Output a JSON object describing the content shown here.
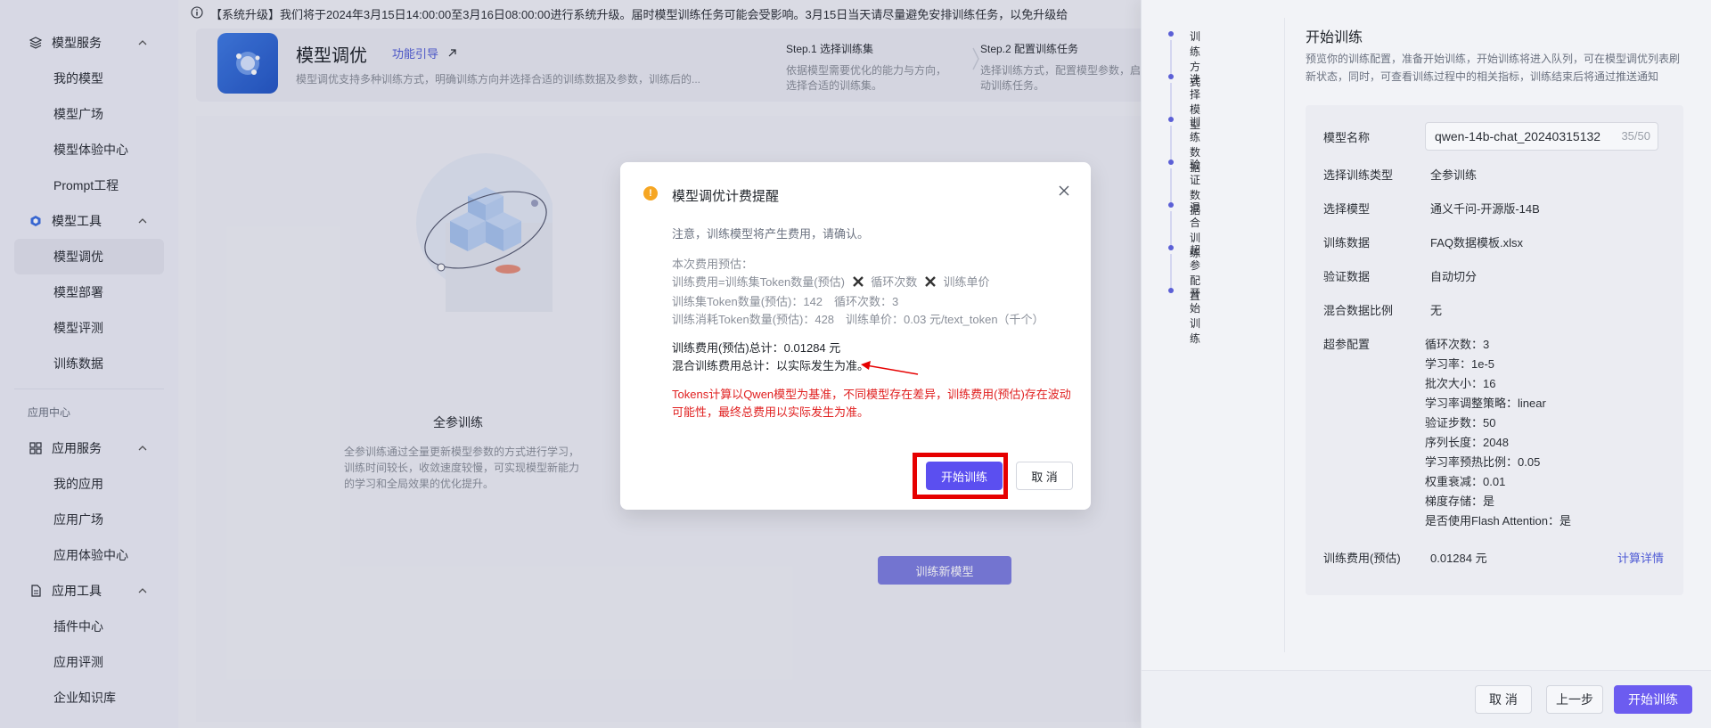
{
  "sidebar": {
    "groups": [
      {
        "label": "模型服务",
        "items": [
          "我的模型",
          "模型广场",
          "模型体验中心",
          "Prompt工程"
        ]
      },
      {
        "label": "模型工具",
        "items": [
          "模型调优",
          "模型部署",
          "模型评测",
          "训练数据"
        ]
      }
    ],
    "section_app": "应用中心",
    "app_groups": [
      {
        "label": "应用服务",
        "items": [
          "我的应用",
          "应用广场",
          "应用体验中心"
        ]
      },
      {
        "label": "应用工具",
        "items": [
          "插件中心",
          "应用评测",
          "企业知识库"
        ]
      }
    ],
    "active_item": "模型调优"
  },
  "notice": "【系统升级】我们将于2024年3月15日14:00:00至3月16日08:00:00进行系统升级。届时模型训练任务可能会受影响。3月15日当天请尽量避免安排训练任务，以免升级给",
  "header": {
    "title": "模型调优",
    "guide_link": "功能引导",
    "desc": "模型调优支持多种训练方式，明确训练方向并选择合适的训练数据及参数，训练后的...",
    "step1_title": "Step.1 选择训练集",
    "step1_desc": "依据模型需要优化的能力与方向，选择合适的训练集。",
    "step2_title": "Step.2 配置训练任务",
    "step2_desc": "选择训练方式，配置模型参数，启动训练任务。"
  },
  "content": {
    "full_train_title": "全参训练",
    "full_train_desc": "全参训练通过全量更新模型参数的方式进行学习，训练时间较长，收敛速度较慢，可实现模型新能力的学习和全局效果的优化提升。",
    "new_model_btn": "训练新模型"
  },
  "modal": {
    "title": "模型调优计费提醒",
    "note": "注意，训练模型将产生费用，请确认。",
    "est_title": "本次费用预估：",
    "formula_a": "训练费用=训练集Token数量(预估)",
    "formula_b": "循环次数",
    "formula_c": "训练单价",
    "token_count": "训练集Token数量(预估)：142　循环次数：3",
    "consume": "训练消耗Token数量(预估)：428　训练单价：0.03 元/text_token（千个）",
    "total": "训练费用(预估)总计：0.01284 元",
    "mixed": "混合训练费用总计：以实际发生为准。",
    "warning": "Tokens计算以Qwen模型为基准，不同模型存在差异，训练费用(预估)存在波动可能性，最终总费用以实际发生为准。",
    "start_btn": "开始训练",
    "cancel_btn": "取 消"
  },
  "drawer": {
    "steps": [
      "训练方式",
      "选择模型",
      "训练数据",
      "验证数据",
      "混合训练",
      "超参配置",
      "开始训练"
    ],
    "title": "开始训练",
    "desc": "预览你的训练配置，准备开始训练，开始训练将进入队列，可在模型调优列表刷新状态，同时，可查看训练过程中的相关指标，训练结束后将通过推送通知",
    "name_label": "模型名称",
    "name_value": "qwen-14b-chat_20240315132",
    "name_count": "35/50",
    "rows": [
      {
        "k": "选择训练类型",
        "v": "全参训练"
      },
      {
        "k": "选择模型",
        "v": "通义千问-开源版-14B"
      },
      {
        "k": "训练数据",
        "v": "FAQ数据模板.xlsx"
      },
      {
        "k": "验证数据",
        "v": "自动切分"
      },
      {
        "k": "混合数据比例",
        "v": "无"
      }
    ],
    "hp_label": "超参配置",
    "hp": [
      "循环次数：3",
      "学习率：1e-5",
      "批次大小：16",
      "学习率调整策略：linear",
      "验证步数：50",
      "序列长度：2048",
      "学习率预热比例：0.05",
      "权重衰减：0.01",
      "梯度存储：是",
      "是否使用Flash Attention：是"
    ],
    "fee_label": "训练费用(预估)",
    "fee_value": "0.01284 元",
    "calc_detail": "计算详情",
    "btn_cancel": "取 消",
    "btn_prev": "上一步",
    "btn_start": "开始训练"
  },
  "colors": {
    "accent": "#5b4ff0",
    "highlight": "#e60000",
    "warning": "#f6a623"
  }
}
